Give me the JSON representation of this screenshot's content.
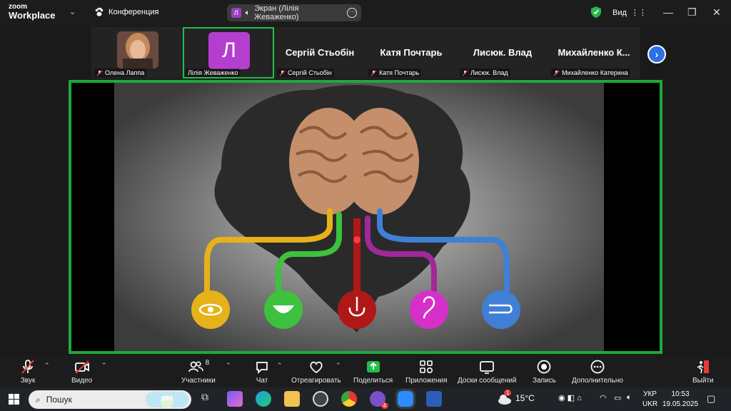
{
  "titlebar": {
    "brand_line1": "zoom",
    "brand_line2": "Workplace",
    "meeting_label": "Конференция",
    "share_avatar_letter": "Л",
    "share_label": "Экран (Лілія Жеваженко)",
    "view_label": "Вид"
  },
  "participants": [
    {
      "display": "",
      "name": "Олена Лаппа",
      "type": "photo"
    },
    {
      "display": "Л",
      "name": "Лілія Жеваженко",
      "type": "avatar",
      "active": true
    },
    {
      "display": "Сергій Стьобін",
      "name": "Сергій Стьобін",
      "type": "text"
    },
    {
      "display": "Катя Почтарь",
      "name": "Катя Почтарь",
      "type": "text"
    },
    {
      "display": "Лисюк. Влад",
      "name": "Лисюк. Влад",
      "type": "text"
    },
    {
      "display": "Михайленко К...",
      "name": "Михайленко Катерина",
      "type": "text"
    }
  ],
  "toolbar": {
    "audio": "Звук",
    "video": "Видео",
    "participants": "Участники",
    "participants_count": "8",
    "chat": "Чат",
    "react": "Отреагировать",
    "share": "Поделиться",
    "apps": "Приложения",
    "whiteboards": "Доски сообщений",
    "record": "Запись",
    "more": "Дополнительно",
    "leave": "Выйти"
  },
  "taskbar": {
    "search_placeholder": "Пошук",
    "notification_badge": "1",
    "viber_badge": "4",
    "temperature": "15°C",
    "lang_top": "УКР",
    "lang_bottom": "UKR",
    "time": "10:53",
    "date": "19.05.2025"
  },
  "colors": {
    "accent_green": "#1fa83a",
    "zoom_blue": "#2e6fe8",
    "avatar_purple": "#b43fcf",
    "sense_sight": "#e6b21a",
    "sense_taste": "#3cc23c",
    "sense_smell": "#b01818",
    "sense_hearing": "#d630c8",
    "sense_touch": "#3f7fd6"
  }
}
